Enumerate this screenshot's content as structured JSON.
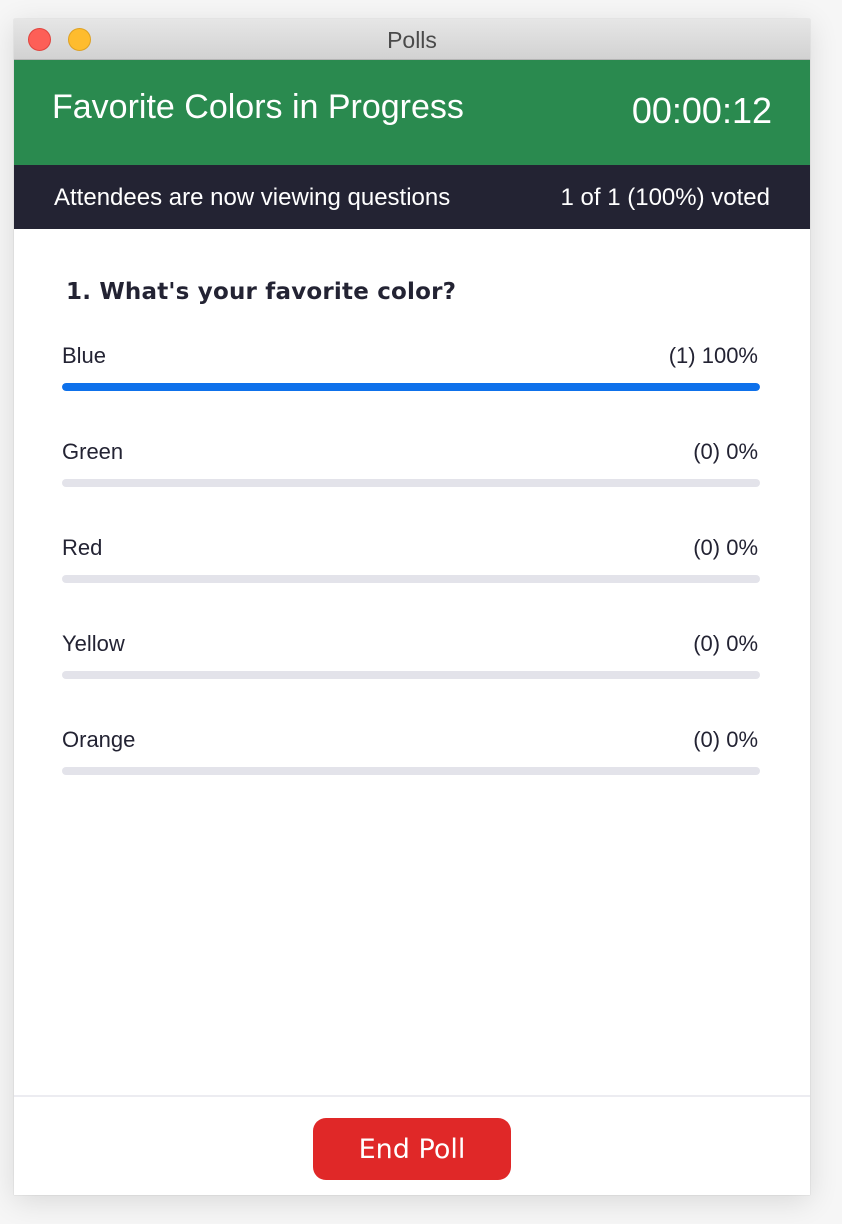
{
  "window": {
    "title": "Polls",
    "controls": [
      "close",
      "minimize"
    ]
  },
  "header": {
    "poll_title": "Favorite Colors in Progress",
    "timer": "00:00:12",
    "background_color": "#2a8a4f"
  },
  "status_bar": {
    "message": "Attendees are now viewing questions",
    "vote_summary": "1 of 1 (100%) voted"
  },
  "question": {
    "text": "1. What's your favorite color?",
    "answers": [
      {
        "label": "Blue",
        "result": "(1) 100%",
        "votes": 1,
        "percent": 100
      },
      {
        "label": "Green",
        "result": "(0) 0%",
        "votes": 0,
        "percent": 0
      },
      {
        "label": "Red",
        "result": "(0) 0%",
        "votes": 0,
        "percent": 0
      },
      {
        "label": "Yellow",
        "result": "(0) 0%",
        "votes": 0,
        "percent": 0
      },
      {
        "label": "Orange",
        "result": "(0) 0%",
        "votes": 0,
        "percent": 0
      }
    ],
    "bar_fill_color": "#0e71eb",
    "bar_track_color": "#e3e3ea"
  },
  "footer": {
    "end_button_label": "End Poll",
    "end_button_color": "#e02828"
  }
}
